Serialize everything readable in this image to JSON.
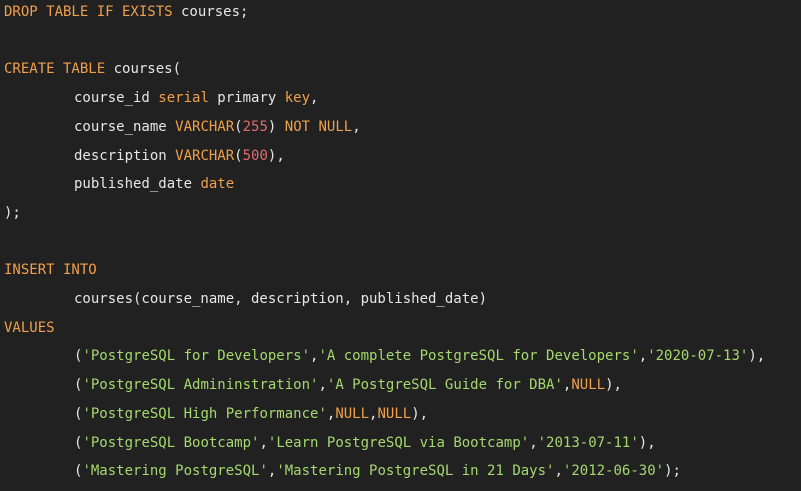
{
  "editor": {
    "colors": {
      "background": "#212121",
      "keyword": "#f0a04b",
      "identifier": "#e6e6e6",
      "string": "#a5d86e",
      "number": "#e06c6c"
    },
    "lines": [
      {
        "indent": 0,
        "tokens": [
          [
            "kw",
            "DROP TABLE IF EXISTS"
          ],
          [
            "id",
            " courses;"
          ]
        ]
      },
      {
        "indent": 0,
        "tokens": []
      },
      {
        "indent": 0,
        "tokens": [
          [
            "kw",
            "CREATE TABLE"
          ],
          [
            "id",
            " courses("
          ]
        ]
      },
      {
        "indent": 1,
        "tokens": [
          [
            "id",
            "course_id "
          ],
          [
            "kw",
            "serial"
          ],
          [
            "id",
            " primary "
          ],
          [
            "kw",
            "key"
          ],
          [
            "id",
            ","
          ]
        ]
      },
      {
        "indent": 1,
        "tokens": [
          [
            "id",
            "course_name "
          ],
          [
            "kw",
            "VARCHAR"
          ],
          [
            "id",
            "("
          ],
          [
            "num",
            "255"
          ],
          [
            "id",
            ") "
          ],
          [
            "kw",
            "NOT NULL"
          ],
          [
            "id",
            ","
          ]
        ]
      },
      {
        "indent": 1,
        "tokens": [
          [
            "id",
            "description "
          ],
          [
            "kw",
            "VARCHAR"
          ],
          [
            "id",
            "("
          ],
          [
            "num",
            "500"
          ],
          [
            "id",
            "),"
          ]
        ]
      },
      {
        "indent": 1,
        "tokens": [
          [
            "id",
            "published_date "
          ],
          [
            "kw",
            "date"
          ]
        ]
      },
      {
        "indent": 0,
        "tokens": [
          [
            "id",
            ");"
          ]
        ]
      },
      {
        "indent": 0,
        "tokens": []
      },
      {
        "indent": 0,
        "tokens": [
          [
            "kw",
            "INSERT INTO"
          ]
        ]
      },
      {
        "indent": 1,
        "tokens": [
          [
            "id",
            "courses(course_name, description, published_date)"
          ]
        ]
      },
      {
        "indent": 0,
        "tokens": [
          [
            "kw",
            "VALUES"
          ]
        ]
      },
      {
        "indent": 1,
        "tokens": [
          [
            "id",
            "("
          ],
          [
            "str",
            "'PostgreSQL for Developers'"
          ],
          [
            "id",
            ","
          ],
          [
            "str",
            "'A complete PostgreSQL for Developers'"
          ],
          [
            "id",
            ","
          ],
          [
            "str",
            "'2020-07-13'"
          ],
          [
            "id",
            "),"
          ]
        ]
      },
      {
        "indent": 1,
        "tokens": [
          [
            "id",
            "("
          ],
          [
            "str",
            "'PostgreSQL Admininstration'"
          ],
          [
            "id",
            ","
          ],
          [
            "str",
            "'A PostgreSQL Guide for DBA'"
          ],
          [
            "id",
            ","
          ],
          [
            "kw",
            "NULL"
          ],
          [
            "id",
            "),"
          ]
        ]
      },
      {
        "indent": 1,
        "tokens": [
          [
            "id",
            "("
          ],
          [
            "str",
            "'PostgreSQL High Performance'"
          ],
          [
            "id",
            ","
          ],
          [
            "kw",
            "NULL"
          ],
          [
            "id",
            ","
          ],
          [
            "kw",
            "NULL"
          ],
          [
            "id",
            "),"
          ]
        ]
      },
      {
        "indent": 1,
        "tokens": [
          [
            "id",
            "("
          ],
          [
            "str",
            "'PostgreSQL Bootcamp'"
          ],
          [
            "id",
            ","
          ],
          [
            "str",
            "'Learn PostgreSQL via Bootcamp'"
          ],
          [
            "id",
            ","
          ],
          [
            "str",
            "'2013-07-11'"
          ],
          [
            "id",
            "),"
          ]
        ]
      },
      {
        "indent": 1,
        "tokens": [
          [
            "id",
            "("
          ],
          [
            "str",
            "'Mastering PostgreSQL'"
          ],
          [
            "id",
            ","
          ],
          [
            "str",
            "'Mastering PostgreSQL in 21 Days'"
          ],
          [
            "id",
            ","
          ],
          [
            "str",
            "'2012-06-30'"
          ],
          [
            "id",
            ");"
          ]
        ]
      }
    ]
  }
}
